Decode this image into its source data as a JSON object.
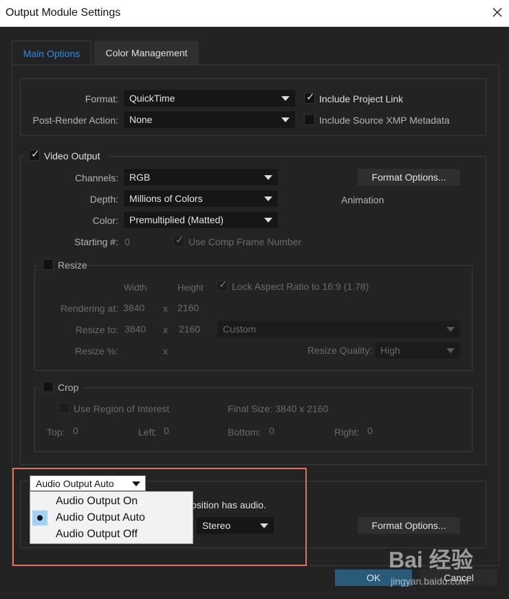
{
  "window": {
    "title": "Output Module Settings"
  },
  "tabs": [
    {
      "label": "Main Options",
      "active": true
    },
    {
      "label": "Color Management",
      "active": false
    }
  ],
  "format": {
    "format_label": "Format:",
    "format_value": "QuickTime",
    "post_render_label": "Post-Render Action:",
    "post_render_value": "None",
    "include_project_link": {
      "label": "Include Project Link",
      "checked": true
    },
    "include_xmp": {
      "label": "Include Source XMP Metadata",
      "checked": false
    }
  },
  "video": {
    "video_output": {
      "label": "Video Output",
      "checked": true
    },
    "channels_label": "Channels:",
    "channels_value": "RGB",
    "depth_label": "Depth:",
    "depth_value": "Millions of Colors",
    "color_label": "Color:",
    "color_value": "Premultiplied (Matted)",
    "starting_label": "Starting #:",
    "starting_value": "0",
    "use_comp_frame": {
      "label": "Use Comp Frame Number",
      "checked": true
    },
    "format_options_button": "Format Options...",
    "codec_info": "Animation"
  },
  "resize": {
    "label": "Resize",
    "checked": false,
    "width_header": "Width",
    "height_header": "Height",
    "lock_aspect": {
      "label": "Lock Aspect Ratio to 16:9 (1.78)",
      "checked": true
    },
    "rendering_at_label": "Rendering at:",
    "rendering_w": "3840",
    "rendering_x": "x",
    "rendering_h": "2160",
    "resize_to_label": "Resize to:",
    "resize_w": "3840",
    "resize_x": "x",
    "resize_h": "2160",
    "preset_value": "Custom",
    "resize_pct_label": "Resize %:",
    "resize_pct_x": "x",
    "quality_label": "Resize Quality:",
    "quality_value": "High"
  },
  "crop": {
    "label": "Crop",
    "checked": false,
    "use_roi": {
      "label": "Use Region of Interest",
      "checked": false
    },
    "final_size": "Final Size: 3840 x 2160",
    "top_label": "Top:",
    "top_value": "0",
    "left_label": "Left:",
    "left_value": "0",
    "bottom_label": "Bottom:",
    "bottom_value": "0",
    "right_label": "Right:",
    "right_value": "0"
  },
  "audio": {
    "dropdown_value": "Audio Output Auto",
    "menu_options": [
      {
        "label": "Audio Output On",
        "selected": false
      },
      {
        "label": "Audio Output Auto",
        "selected": true
      },
      {
        "label": "Audio Output Off",
        "selected": false
      }
    ],
    "hint_partial": "osition has audio.",
    "channels_value": "Stereo",
    "format_options_button": "Format Options..."
  },
  "footer": {
    "ok_label": "OK",
    "cancel_label": "Cancel"
  },
  "watermark": {
    "logo": "Bai 经验",
    "sub": "jingyan.baidu.com"
  },
  "colors": {
    "accent": "#2d8ceb",
    "highlight": "#e3735e",
    "selected": "#9fd0f5"
  }
}
